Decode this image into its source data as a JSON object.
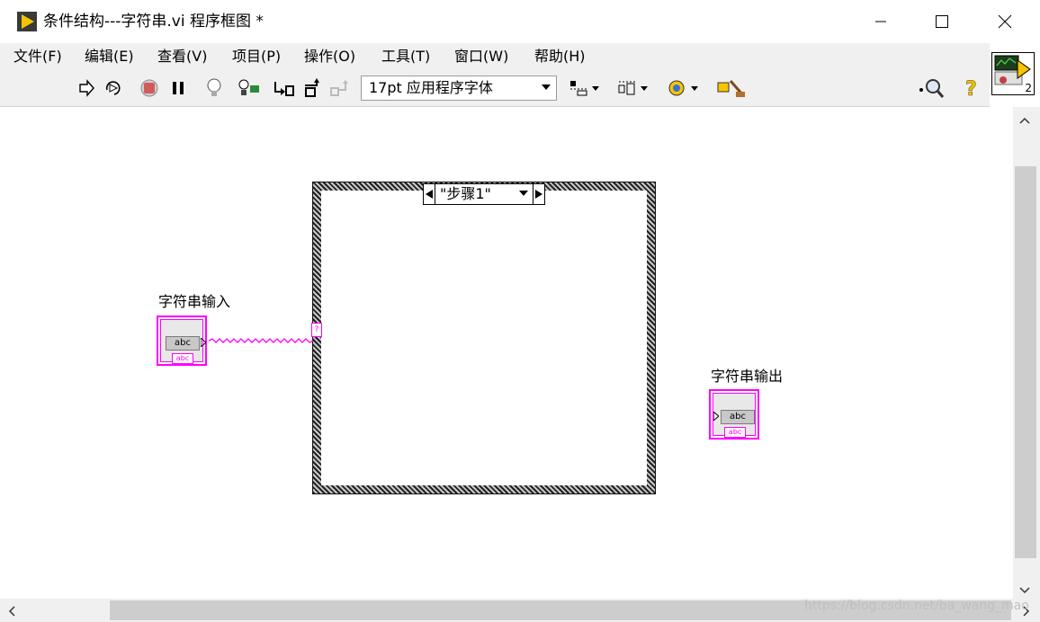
{
  "window": {
    "title": "条件结构---字符串.vi 程序框图 *"
  },
  "menu": {
    "items": [
      {
        "label": "文件(F)"
      },
      {
        "label": "编辑(E)"
      },
      {
        "label": "查看(V)"
      },
      {
        "label": "项目(P)"
      },
      {
        "label": "操作(O)"
      },
      {
        "label": "工具(T)"
      },
      {
        "label": "窗口(W)"
      },
      {
        "label": "帮助(H)"
      }
    ]
  },
  "toolbar": {
    "font_select_value": "17pt 应用程序字体",
    "icons": [
      "run-arrow-icon",
      "run-continuously-icon",
      "abort-icon",
      "pause-icon",
      "highlight-execution-icon",
      "retain-wire-values-icon",
      "step-into-icon",
      "step-over-icon",
      "step-out-icon",
      "align-objects-icon",
      "distribute-objects-icon",
      "reorder-icon",
      "clean-up-diagram-icon",
      "search-icon",
      "context-help-icon"
    ]
  },
  "connector_pane": {
    "number": "2"
  },
  "case_structure": {
    "selector_value": "\"步骤1\"",
    "tunnel_label": "?"
  },
  "controls": {
    "input": {
      "label": "字符串输入",
      "display": "abc",
      "type": "abc"
    },
    "output": {
      "label": "字符串输出",
      "display": "abc",
      "type": "abc"
    }
  },
  "watermark": "https://blog.csdn.net/ba_wang_mao",
  "colors": {
    "string_wire": "#ff00ff",
    "menu_bg": "#f0f0f0"
  }
}
